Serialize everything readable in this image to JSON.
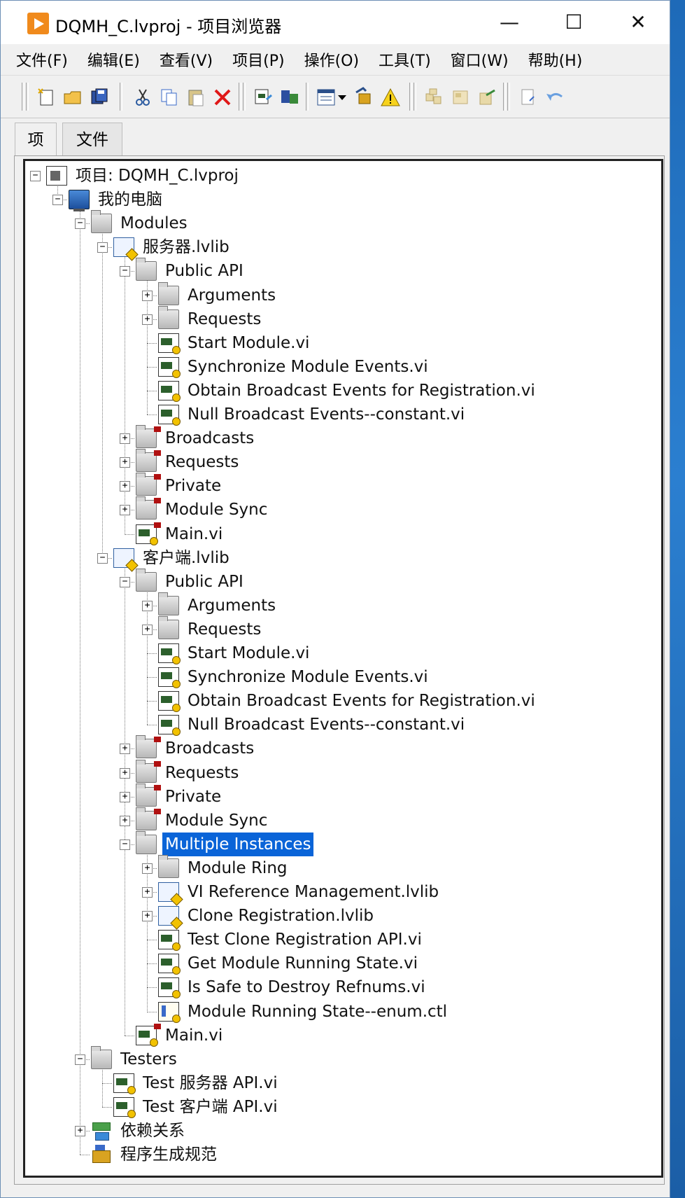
{
  "window": {
    "title": "DQMH_C.lvproj - 项目浏览器",
    "minimize": "—",
    "maximize": "☐",
    "close": "✕"
  },
  "menu": [
    "文件(F)",
    "编辑(E)",
    "查看(V)",
    "项目(P)",
    "操作(O)",
    "工具(T)",
    "窗口(W)",
    "帮助(H)"
  ],
  "toolbar": {
    "icons": [
      "new-icon",
      "open-folder-icon",
      "save-all-icon",
      "cut-icon",
      "copy-icon",
      "paste-icon",
      "delete-icon",
      "build-icon",
      "deploy-icon",
      "view-options-icon",
      "dropdown-arrow-icon",
      "customize-icon",
      "warning-icon",
      "library-icon",
      "class-icon",
      "export-icon",
      "properties-icon",
      "undo-icon"
    ]
  },
  "tabs": [
    "项",
    "文件"
  ],
  "tree": [
    {
      "label": "项目: DQMH_C.lvproj",
      "level": 0,
      "icon": "project",
      "exp": "-"
    },
    {
      "label": "我的电脑",
      "level": 1,
      "icon": "computer",
      "exp": "-"
    },
    {
      "label": "Modules",
      "level": 2,
      "icon": "folder",
      "exp": "-"
    },
    {
      "label": "服务器.lvlib",
      "level": 3,
      "icon": "lib",
      "exp": "-"
    },
    {
      "label": "Public API",
      "level": 4,
      "icon": "folder",
      "exp": "-"
    },
    {
      "label": "Arguments",
      "level": 5,
      "icon": "folder",
      "exp": "+"
    },
    {
      "label": "Requests",
      "level": 5,
      "icon": "folder",
      "exp": "+"
    },
    {
      "label": "Start Module.vi",
      "level": 5,
      "icon": "vi"
    },
    {
      "label": "Synchronize Module Events.vi",
      "level": 5,
      "icon": "vi"
    },
    {
      "label": "Obtain Broadcast Events for Registration.vi",
      "level": 5,
      "icon": "vi"
    },
    {
      "label": "Null Broadcast Events--constant.vi",
      "level": 5,
      "icon": "vi"
    },
    {
      "label": "Broadcasts",
      "level": 4,
      "icon": "folder",
      "exp": "+",
      "flag": true
    },
    {
      "label": "Requests",
      "level": 4,
      "icon": "folder",
      "exp": "+",
      "flag": true
    },
    {
      "label": "Private",
      "level": 4,
      "icon": "folder",
      "exp": "+",
      "flag": true
    },
    {
      "label": "Module Sync",
      "level": 4,
      "icon": "folder",
      "exp": "+",
      "flag": true
    },
    {
      "label": "Main.vi",
      "level": 4,
      "icon": "vi",
      "flag": true
    },
    {
      "label": "客户端.lvlib",
      "level": 3,
      "icon": "lib",
      "exp": "-"
    },
    {
      "label": "Public API",
      "level": 4,
      "icon": "folder",
      "exp": "-"
    },
    {
      "label": "Arguments",
      "level": 5,
      "icon": "folder",
      "exp": "+"
    },
    {
      "label": "Requests",
      "level": 5,
      "icon": "folder",
      "exp": "+"
    },
    {
      "label": "Start Module.vi",
      "level": 5,
      "icon": "vi"
    },
    {
      "label": "Synchronize Module Events.vi",
      "level": 5,
      "icon": "vi"
    },
    {
      "label": "Obtain Broadcast Events for Registration.vi",
      "level": 5,
      "icon": "vi"
    },
    {
      "label": "Null Broadcast Events--constant.vi",
      "level": 5,
      "icon": "vi"
    },
    {
      "label": "Broadcasts",
      "level": 4,
      "icon": "folder",
      "exp": "+",
      "flag": true
    },
    {
      "label": "Requests",
      "level": 4,
      "icon": "folder",
      "exp": "+",
      "flag": true
    },
    {
      "label": "Private",
      "level": 4,
      "icon": "folder",
      "exp": "+",
      "flag": true
    },
    {
      "label": "Module Sync",
      "level": 4,
      "icon": "folder",
      "exp": "+",
      "flag": true
    },
    {
      "label": "Multiple Instances",
      "level": 4,
      "icon": "folder",
      "exp": "-",
      "selected": true
    },
    {
      "label": "Module Ring",
      "level": 5,
      "icon": "folder",
      "exp": "+"
    },
    {
      "label": "VI Reference Management.lvlib",
      "level": 5,
      "icon": "lib",
      "exp": "+"
    },
    {
      "label": "Clone Registration.lvlib",
      "level": 5,
      "icon": "lib",
      "exp": "+"
    },
    {
      "label": "Test Clone Registration API.vi",
      "level": 5,
      "icon": "vi"
    },
    {
      "label": "Get Module Running State.vi",
      "level": 5,
      "icon": "vi"
    },
    {
      "label": "Is Safe to Destroy Refnums.vi",
      "level": 5,
      "icon": "vi"
    },
    {
      "label": "Module Running State--enum.ctl",
      "level": 5,
      "icon": "ctl"
    },
    {
      "label": "Main.vi",
      "level": 4,
      "icon": "vi",
      "flag": true
    },
    {
      "label": "Testers",
      "level": 2,
      "icon": "folder",
      "exp": "-"
    },
    {
      "label": "Test 服务器 API.vi",
      "level": 3,
      "icon": "vi"
    },
    {
      "label": "Test 客户端 API.vi",
      "level": 3,
      "icon": "vi"
    },
    {
      "label": "依赖关系",
      "level": 2,
      "icon": "deps",
      "exp": "+"
    },
    {
      "label": "程序生成规范",
      "level": 2,
      "icon": "build"
    }
  ]
}
